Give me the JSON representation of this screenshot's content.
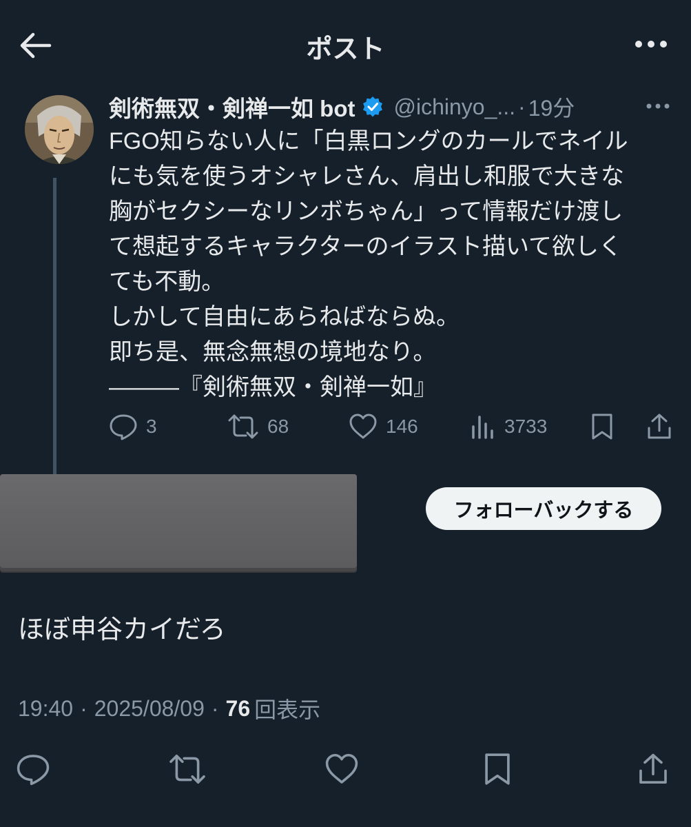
{
  "header": {
    "title": "ポスト",
    "back_icon": "arrow-left-icon",
    "more_icon": "more-horizontal-icon"
  },
  "parent_tweet": {
    "display_name": "剣術無双・剣禅一如 bot",
    "handle": "@ichinyo_...",
    "separator": "·",
    "time_ago": "19分",
    "text": "FGO知らない人に「白黒ロングのカールでネイル\nにも気を使うオシャレさん、肩出し和服で大きな\n胸がセクシーなリンボちゃん」って情報だけ渡し\nて想起するキャラクターのイラスト描いて欲しく\nても不動。\nしかして自由にあらねばならぬ。\n即ち是、無念無想の境地なり。\n———『剣術無双・剣禅一如』",
    "reply_count": "3",
    "retweet_count": "68",
    "like_count": "146",
    "view_count": "3733",
    "verified_color": "#1d9bf0"
  },
  "follow_button": {
    "label": "フォローバックする"
  },
  "reply": {
    "text": "ほぼ申谷カイだろ",
    "time": "19:40",
    "sep1": "·",
    "date": "2025/08/09",
    "sep2": "·",
    "views_num": "76",
    "views_label": "回表示"
  },
  "colors": {
    "background": "#15202b",
    "text": "#e7e9ea",
    "secondary": "#8b98a5",
    "thread_line": "#425364",
    "follow_bg": "#eff3f4"
  }
}
